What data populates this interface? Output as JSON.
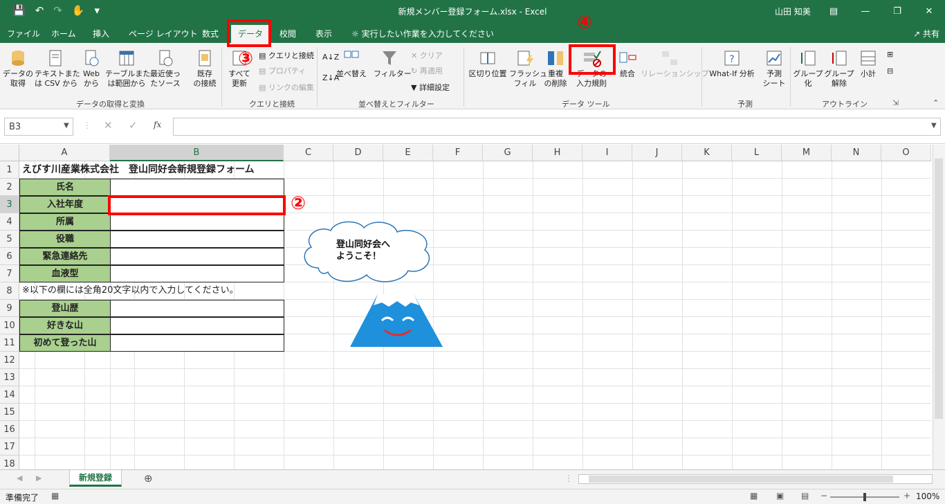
{
  "window": {
    "title": "新規メンバー登録フォーム.xlsx  -  Excel",
    "user": "山田 知美"
  },
  "tabs": [
    {
      "label": "ファイル"
    },
    {
      "label": "ホーム"
    },
    {
      "label": "挿入"
    },
    {
      "label": "ページ レイアウト"
    },
    {
      "label": "数式"
    },
    {
      "label": "データ"
    },
    {
      "label": "校閲"
    },
    {
      "label": "表示"
    }
  ],
  "tell_me": "実行したい作業を入力してください",
  "share": "共有",
  "ribbon": {
    "get_data": "データの\n取得",
    "from_text": "テキストまた\nは CSV から",
    "from_web": "Web\nから",
    "from_table": "テーブルまた\nは範囲から",
    "recent": "最近使っ\nたソース",
    "existing": "既存\nの接続",
    "refresh_all": "すべて\n更新",
    "queries": "クエリと接続",
    "properties": "プロパティ",
    "edit_links": "リンクの編集",
    "sort": "並べ替え",
    "filter": "フィルター",
    "clear": "クリア",
    "reapply": "再適用",
    "advanced": "詳細設定",
    "text_to_columns": "区切り位置",
    "flash_fill": "フラッシュ\nフィル",
    "remove_dup": "重複\nの削除",
    "data_validation": "データの\n入力規則",
    "consolidate": "統合",
    "relationships": "リレーションシップ",
    "what_if": "What-If 分析",
    "forecast": "予測\nシート",
    "group": "グループ\n化",
    "ungroup": "グループ\n解除",
    "subtotal": "小計",
    "groups": {
      "get_transform": "データの取得と変換",
      "queries": "クエリと接続",
      "sort_filter": "並べ替えとフィルター",
      "data_tools": "データ ツール",
      "forecast": "予測",
      "outline": "アウトライン"
    }
  },
  "formula_bar": {
    "name_box": "B3",
    "fx": "fx",
    "value": ""
  },
  "columns": [
    "A",
    "B",
    "C",
    "D",
    "E",
    "F",
    "G",
    "H",
    "I",
    "J",
    "K",
    "L",
    "M",
    "N",
    "O"
  ],
  "rows": [
    "1",
    "2",
    "3",
    "4",
    "5",
    "6",
    "7",
    "8",
    "9",
    "10",
    "11",
    "12",
    "13",
    "14",
    "15",
    "16",
    "17",
    "18"
  ],
  "sheet": {
    "title": "えびす川産業株式会社　登山同好会新規登録フォーム",
    "labels": [
      "氏名",
      "入社年度",
      "所属",
      "役職",
      "緊急連絡先",
      "血液型"
    ],
    "note": "※以下の欄には全角20文字以内で入力してください。",
    "labels2": [
      "登山歴",
      "好きな山",
      "初めて登った山"
    ]
  },
  "bubble": "登山同好会へ\nようこそ！",
  "annotations": {
    "n2": "②",
    "n3": "③",
    "n4": "④"
  },
  "sheet_tab": "新規登録",
  "status": {
    "ready": "準備完了",
    "zoom": "100%"
  }
}
